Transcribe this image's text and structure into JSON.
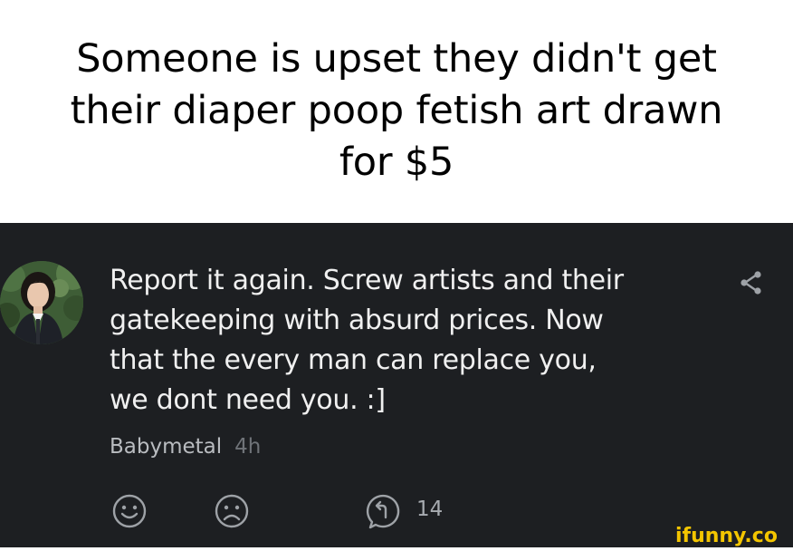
{
  "caption": {
    "lines": [
      "Someone is upset they didn't get",
      "their diaper poop fetish art drawn",
      "for $5"
    ]
  },
  "comment": {
    "avatar_icon": "user-photo-avatar",
    "text_lines": [
      "Report it again. Screw artists and their",
      "gatekeeping with absurd prices. Now",
      "that the every man can replace you,",
      "we dont need you. :]"
    ],
    "author": "Babymetal",
    "time": "4h",
    "share_icon": "share-icon",
    "actions": {
      "smile_icon": "smile-icon",
      "frown_icon": "frown-icon",
      "reply_icon": "reply-icon",
      "reply_count": "14"
    }
  },
  "watermark": {
    "text": "ifunny.co"
  },
  "colors": {
    "panel_bg": "#1d1f22",
    "comment_text": "#f0f0f0",
    "meta_text": "#b9bcc0",
    "time_text": "#6f7378",
    "icon": "#9ea2a7",
    "watermark": "#f3c500"
  }
}
